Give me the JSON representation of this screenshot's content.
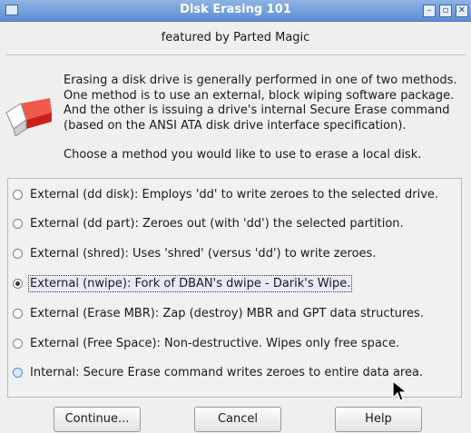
{
  "window": {
    "title": "Disk Erasing 101",
    "subtitle": "featured by Parted Magic",
    "controls": {
      "minimize": "–",
      "maximize": "▫",
      "close": "✕"
    }
  },
  "description": {
    "lines": [
      "Erasing a disk drive is generally performed in one of two methods.",
      "One method is to use an external, block wiping software package.",
      "And the other is issuing a drive's internal Secure Erase command",
      "(based on the ANSI ATA disk drive interface specification)."
    ],
    "prompt": "Choose a method you would like to use to erase a local disk."
  },
  "options": [
    {
      "label": "External (dd disk): Employs 'dd' to write zeroes to the selected drive.",
      "selected": false
    },
    {
      "label": "External (dd part): Zeroes out (with 'dd') the selected partition.",
      "selected": false
    },
    {
      "label": "External (shred): Uses 'shred' (versus 'dd') to write zeroes.",
      "selected": false
    },
    {
      "label": "External (nwipe): Fork of DBAN's dwipe - Darik's Wipe.",
      "selected": true
    },
    {
      "label": "External (Erase MBR): Zap (destroy) MBR and GPT data structures.",
      "selected": false
    },
    {
      "label": "External (Free Space): Non-destructive. Wipes only free space.",
      "selected": false
    },
    {
      "label": "Internal: Secure Erase command writes zeroes to entire data area.",
      "selected": false
    }
  ],
  "buttons": {
    "continue": "Continue...",
    "cancel": "Cancel",
    "help": "Help"
  },
  "icons": {
    "eraser": "eraser-icon",
    "app": "window-icon",
    "cursor": "mouse-pointer-icon"
  },
  "colors": {
    "titlebar": "#6f9cda",
    "eraser_red": "#d8231f"
  }
}
